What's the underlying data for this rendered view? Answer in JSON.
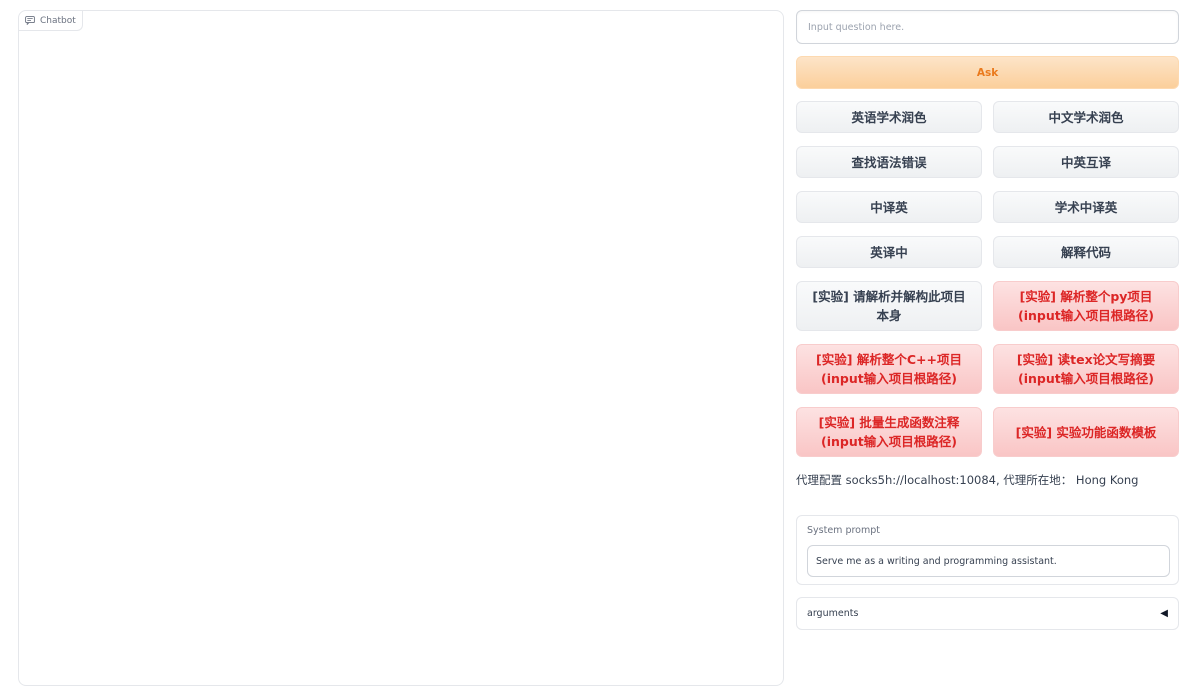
{
  "chatbot": {
    "label": "Chatbot",
    "icon": "chat-icon"
  },
  "input": {
    "placeholder": "Input question here.",
    "value": ""
  },
  "ask_button": {
    "label": "Ask",
    "color": "#ea7a1d"
  },
  "function_buttons": [
    {
      "label": "英语学术润色",
      "style": "gray"
    },
    {
      "label": "中文学术润色",
      "style": "gray"
    },
    {
      "label": "查找语法错误",
      "style": "gray"
    },
    {
      "label": "中英互译",
      "style": "gray"
    },
    {
      "label": "中译英",
      "style": "gray"
    },
    {
      "label": "学术中译英",
      "style": "gray"
    },
    {
      "label": "英译中",
      "style": "gray"
    },
    {
      "label": "解释代码",
      "style": "gray"
    },
    {
      "label": "[实验] 请解析并解构此项目本身",
      "style": "gray"
    },
    {
      "label": "[实验] 解析整个py项目(input输入项目根路径)",
      "style": "red"
    },
    {
      "label": "[实验] 解析整个C++项目(input输入项目根路径)",
      "style": "red"
    },
    {
      "label": "[实验] 读tex论文写摘要(input输入项目根路径)",
      "style": "red"
    },
    {
      "label": "[实验] 批量生成函数注释(input输入项目根路径)",
      "style": "red"
    },
    {
      "label": "[实验] 实验功能函数模板",
      "style": "red"
    }
  ],
  "proxy": {
    "text": "代理配置 socks5h://localhost:10084, 代理所在地： Hong Kong"
  },
  "system_prompt": {
    "label": "System prompt",
    "value": "Serve me as a writing and programming assistant."
  },
  "arguments": {
    "label": "arguments",
    "icon": "triangle-left-icon"
  },
  "colors": {
    "accent_orange": "#ea7a1d",
    "experimental_red": "#dc2626"
  }
}
